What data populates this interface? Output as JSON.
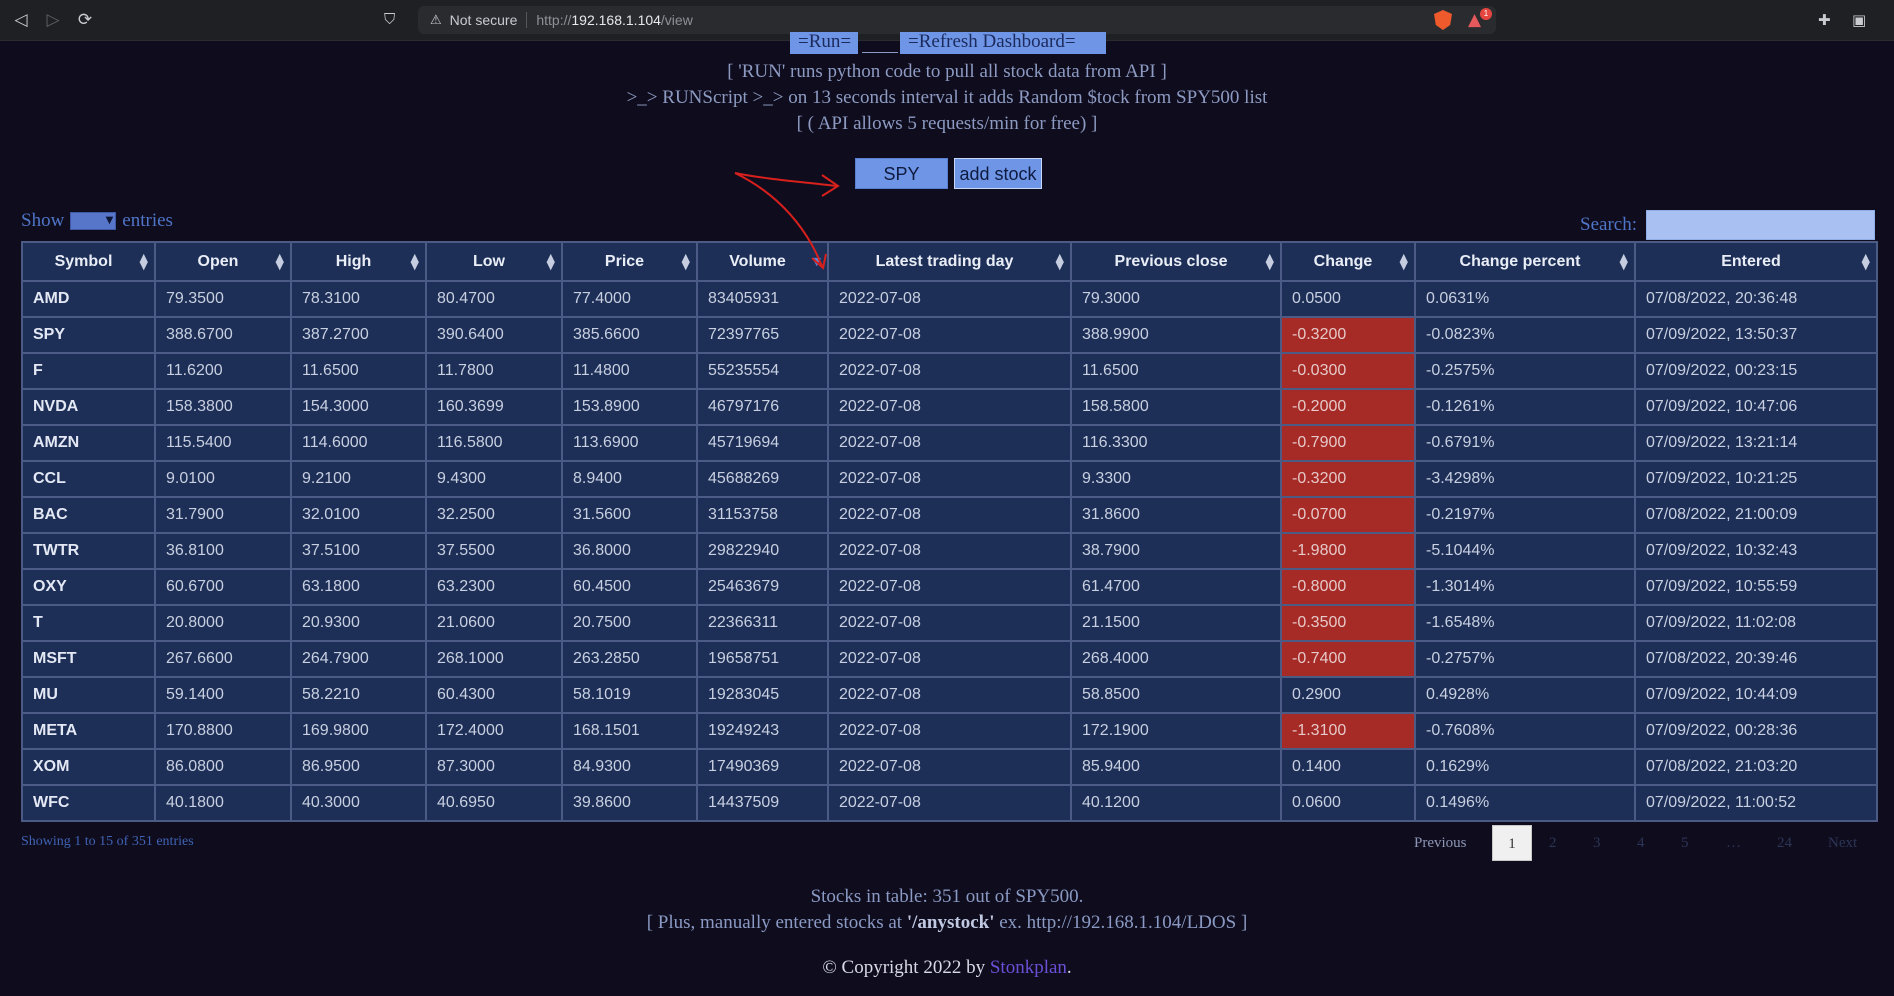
{
  "browser": {
    "security_text": "Not secure",
    "url_protocol": "http://",
    "url_host": "192.168.1.104",
    "url_path": "/view",
    "rewards_badge": "1"
  },
  "header": {
    "run_button": "=Run=",
    "refresh_button": "=Refresh Dashboard=",
    "info_line1": "[ 'RUN' runs python code to pull all stock data from API ]",
    "info_line2": ">_> RUNScript >_> on 13 seconds interval it adds Random $tock from SPY500 list",
    "info_line3": "[ ( API allows 5 requests/min for free) ]",
    "spy_button": "SPY",
    "add_stock_button": "add stock"
  },
  "controls": {
    "show_label": "Show",
    "entries_label": "entries",
    "search_label": "Search:",
    "search_value": ""
  },
  "table": {
    "columns": [
      "Symbol",
      "Open",
      "High",
      "Low",
      "Price",
      "Volume",
      "Latest trading day",
      "Previous close",
      "Change",
      "Change percent",
      "Entered"
    ],
    "sorted_column": "Volume",
    "rows": [
      [
        "AMD",
        "79.3500",
        "78.3100",
        "80.4700",
        "77.4000",
        "83405931",
        "2022-07-08",
        "79.3000",
        "0.0500",
        "0.0631%",
        "07/08/2022, 20:36:48"
      ],
      [
        "SPY",
        "388.6700",
        "387.2700",
        "390.6400",
        "385.6600",
        "72397765",
        "2022-07-08",
        "388.9900",
        "-0.3200",
        "-0.0823%",
        "07/09/2022, 13:50:37"
      ],
      [
        "F",
        "11.6200",
        "11.6500",
        "11.7800",
        "11.4800",
        "55235554",
        "2022-07-08",
        "11.6500",
        "-0.0300",
        "-0.2575%",
        "07/09/2022, 00:23:15"
      ],
      [
        "NVDA",
        "158.3800",
        "154.3000",
        "160.3699",
        "153.8900",
        "46797176",
        "2022-07-08",
        "158.5800",
        "-0.2000",
        "-0.1261%",
        "07/09/2022, 10:47:06"
      ],
      [
        "AMZN",
        "115.5400",
        "114.6000",
        "116.5800",
        "113.6900",
        "45719694",
        "2022-07-08",
        "116.3300",
        "-0.7900",
        "-0.6791%",
        "07/09/2022, 13:21:14"
      ],
      [
        "CCL",
        "9.0100",
        "9.2100",
        "9.4300",
        "8.9400",
        "45688269",
        "2022-07-08",
        "9.3300",
        "-0.3200",
        "-3.4298%",
        "07/09/2022, 10:21:25"
      ],
      [
        "BAC",
        "31.7900",
        "32.0100",
        "32.2500",
        "31.5600",
        "31153758",
        "2022-07-08",
        "31.8600",
        "-0.0700",
        "-0.2197%",
        "07/08/2022, 21:00:09"
      ],
      [
        "TWTR",
        "36.8100",
        "37.5100",
        "37.5500",
        "36.8000",
        "29822940",
        "2022-07-08",
        "38.7900",
        "-1.9800",
        "-5.1044%",
        "07/09/2022, 10:32:43"
      ],
      [
        "OXY",
        "60.6700",
        "63.1800",
        "63.2300",
        "60.4500",
        "25463679",
        "2022-07-08",
        "61.4700",
        "-0.8000",
        "-1.3014%",
        "07/09/2022, 10:55:59"
      ],
      [
        "T",
        "20.8000",
        "20.9300",
        "21.0600",
        "20.7500",
        "22366311",
        "2022-07-08",
        "21.1500",
        "-0.3500",
        "-1.6548%",
        "07/09/2022, 11:02:08"
      ],
      [
        "MSFT",
        "267.6600",
        "264.7900",
        "268.1000",
        "263.2850",
        "19658751",
        "2022-07-08",
        "268.4000",
        "-0.7400",
        "-0.2757%",
        "07/08/2022, 20:39:46"
      ],
      [
        "MU",
        "59.1400",
        "58.2210",
        "60.4300",
        "58.1019",
        "19283045",
        "2022-07-08",
        "58.8500",
        "0.2900",
        "0.4928%",
        "07/09/2022, 10:44:09"
      ],
      [
        "META",
        "170.8800",
        "169.9800",
        "172.4000",
        "168.1501",
        "19249243",
        "2022-07-08",
        "172.1900",
        "-1.3100",
        "-0.7608%",
        "07/09/2022, 00:28:36"
      ],
      [
        "XOM",
        "86.0800",
        "86.9500",
        "87.3000",
        "84.9300",
        "17490369",
        "2022-07-08",
        "85.9400",
        "0.1400",
        "0.1629%",
        "07/08/2022, 21:03:20"
      ],
      [
        "WFC",
        "40.1800",
        "40.3000",
        "40.6950",
        "39.8600",
        "14437509",
        "2022-07-08",
        "40.1200",
        "0.0600",
        "0.1496%",
        "07/09/2022, 11:00:52"
      ]
    ]
  },
  "pagination": {
    "info": "Showing 1 to 15 of 351 entries",
    "previous": "Previous",
    "pages": [
      "1",
      "2",
      "3",
      "4",
      "5",
      "…",
      "24"
    ],
    "next": "Next"
  },
  "footer": {
    "line1": "Stocks in table: 351 out of SPY500.",
    "line2_pre": "[ Plus, manually entered stocks at ",
    "line2_bold": "'/anystock'",
    "line2_post": " ex. http://192.168.1.104/LDOS ]",
    "copyright": "© Copyright 2022 by ",
    "brand": "Stonkplan",
    "period": "."
  },
  "colors": {
    "page_bg": "#0f0c1e",
    "table_bg": "#1d2f57",
    "negative_change": "#a62a26",
    "button_bg": "#6f96e6",
    "annotation_arrow": "#d8201c"
  },
  "icons": [
    "back-icon",
    "forward-icon",
    "reload-icon",
    "bookmark-icon",
    "warning-icon",
    "brave-shield-icon",
    "brave-rewards-icon",
    "extensions-icon",
    "wallet-icon",
    "sort-icon"
  ]
}
